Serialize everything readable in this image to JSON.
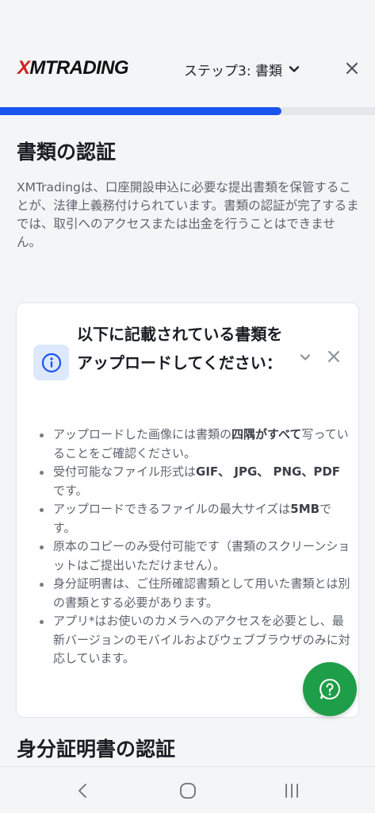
{
  "header": {
    "logo_x": "X",
    "logo_rest": "MTRADING",
    "step_label": "ステップ3: 書類"
  },
  "progress": {
    "fraction": 0.75,
    "color": "#1a55ee"
  },
  "main": {
    "title": "書類の認証",
    "intro": "XMTradingは、口座開設申込に必要な提出書類を保管することが、法律上義務付けられています。書類の認証が完了するまでは、取引へのアクセスまたは出金を行うことはできません。"
  },
  "notice": {
    "title": "以下に記載されている書類をアップロードしてください：",
    "icon": "info-icon",
    "bullets": [
      {
        "pre": "アップロードした画像には書類の",
        "bold": "四隅がすべて",
        "post": "写っていることをご確認ください。"
      },
      {
        "pre": "受付可能なファイル形式は",
        "bold": "GIF、 JPG、 PNG、PDF",
        "post": "です。"
      },
      {
        "pre": "アップロードできるファイルの最大サイズは",
        "bold": "5MB",
        "post": "です。"
      },
      {
        "pre": "原本のコピーのみ受付可能です（書類のスクリーンショットはご提出いただけません）。",
        "bold": "",
        "post": ""
      },
      {
        "pre": "身分証明書は、ご住所確認書類として用いた書類とは別の書類とする必要があります。",
        "bold": "",
        "post": ""
      },
      {
        "pre": "アプリ*はお使いのカメラへのアクセスを必要とし、最新バージョンのモバイルおよびウェブブラウザのみに対応しています。",
        "bold": "",
        "post": ""
      }
    ]
  },
  "next_section": {
    "title": "身分証明書の認証"
  },
  "colors": {
    "accent": "#1a55ee",
    "logo_red": "#d0201c",
    "help_green": "#1e9e48",
    "info_bg": "#dde8fb"
  }
}
